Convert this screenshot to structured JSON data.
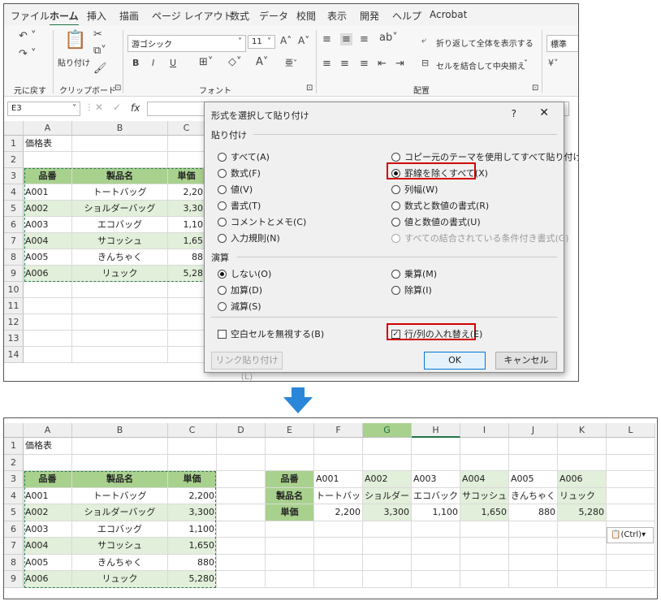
{
  "menu": [
    "ファイル",
    "ホーム",
    "挿入",
    "描画",
    "ページ レイアウト",
    "数式",
    "データ",
    "校閲",
    "表示",
    "開発",
    "ヘルプ",
    "Acrobat"
  ],
  "ribbon": {
    "undo_label": "元に戻す",
    "paste_label": "貼り付け",
    "clipboard_label": "クリップボード",
    "font_name": "游ゴシック",
    "font_size": "11",
    "font_group_label": "フォント",
    "wrap_label": "折り返して全体を表示する",
    "merge_label": "セルを結合して中央揃え",
    "align_group_label": "配置",
    "number_format": "標準",
    "bold": "B",
    "italic": "I",
    "underline": "U"
  },
  "formula_bar": {
    "name_box": "E3",
    "fx": "fx"
  },
  "top_sheet": {
    "columns": [
      "A",
      "B",
      "C"
    ],
    "rows": [
      "1",
      "2",
      "3",
      "4",
      "5",
      "6",
      "7",
      "8",
      "9",
      "10",
      "11",
      "12",
      "13",
      "14"
    ]
  },
  "table": {
    "title": "価格表",
    "headers": [
      "品番",
      "製品名",
      "単価"
    ],
    "rows": [
      [
        "A001",
        "トートバッグ",
        "2,200"
      ],
      [
        "A002",
        "ショルダーバッグ",
        "3,300"
      ],
      [
        "A003",
        "エコバッグ",
        "1,100"
      ],
      [
        "A004",
        "サコッシュ",
        "1,650"
      ],
      [
        "A005",
        "きんちゃく",
        "880"
      ],
      [
        "A006",
        "リュック",
        "5,280"
      ]
    ],
    "top_truncated": [
      "2,20",
      "3,30",
      "1,10",
      "1,65",
      "88",
      "5,28"
    ]
  },
  "dialog": {
    "title": "形式を選択して貼り付け",
    "help": "?",
    "close": "✕",
    "paste_section": "貼り付け",
    "paste_left": [
      "すべて(A)",
      "数式(F)",
      "値(V)",
      "書式(T)",
      "コメントとメモ(C)",
      "入力規則(N)"
    ],
    "paste_right": [
      "コピー元のテーマを使用してすべて貼り付け(H)",
      "罫線を除くすべて(X)",
      "列幅(W)",
      "数式と数値の書式(R)",
      "値と数値の書式(U)",
      "すべての結合されている条件付き書式(G)"
    ],
    "op_section": "演算",
    "op_left": [
      "しない(O)",
      "加算(D)",
      "減算(S)"
    ],
    "op_right": [
      "乗算(M)",
      "除算(I)"
    ],
    "skip_blanks": "空白セルを無視する(B)",
    "transpose": "行/列の入れ替え(E)",
    "link_button": "リンク貼り付け(L)",
    "ok": "OK",
    "cancel": "キャンセル"
  },
  "bottom_sheet": {
    "columns": [
      "A",
      "B",
      "C",
      "D",
      "E",
      "F",
      "G",
      "H",
      "I",
      "J",
      "K",
      "L"
    ],
    "rows": [
      "1",
      "2",
      "3",
      "4",
      "5",
      "6",
      "7",
      "8",
      "9"
    ],
    "transposed": {
      "labels": [
        "品番",
        "製品名",
        "単価"
      ],
      "codes": [
        "A001",
        "A002",
        "A003",
        "A004",
        "A005",
        "A006"
      ],
      "names": [
        "トートバッ",
        "ショルダー",
        "エコバック",
        "サコッシュ",
        "きんちゃく",
        "リュック"
      ],
      "prices": [
        "2,200",
        "3,300",
        "1,100",
        "1,650",
        "880",
        "5,280"
      ]
    },
    "ctrl_tag": "(Ctrl)"
  }
}
